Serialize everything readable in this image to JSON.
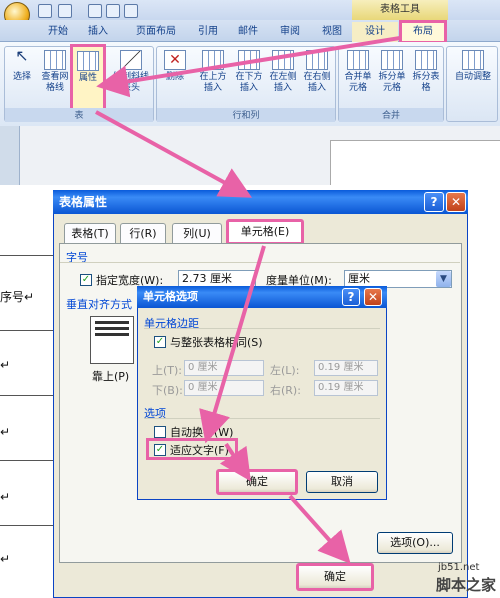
{
  "ribbon": {
    "context_tools": "表格工具",
    "tabs": [
      "开始",
      "插入",
      "页面布局",
      "引用",
      "邮件",
      "审阅",
      "视图",
      "设计",
      "布局"
    ],
    "groups": {
      "table": {
        "label": "表",
        "select": "选择",
        "gridlines": "查看网格线",
        "properties": "属性"
      },
      "draw": {
        "label": "绘制斜线表头"
      },
      "rows_cols": {
        "label": "行和列",
        "delete": "删除",
        "insert_above": "在上方插入",
        "insert_below": "在下方插入",
        "insert_left": "在左侧插入",
        "insert_right": "在右侧插入"
      },
      "merge": {
        "label": "合并",
        "merge_cells": "合并单元格",
        "split_cells": "拆分单元格",
        "split_table": "拆分表格"
      },
      "autofit": {
        "label": "自动调整"
      }
    }
  },
  "document": {
    "left_fragment_1": "序号↵",
    "left_fragment_2": "↵"
  },
  "table_props": {
    "title": "表格属性",
    "tabs": [
      "表格(T)",
      "行(R)",
      "列(U)",
      "单元格(E)"
    ],
    "section_size": "字号",
    "preferred_width_label": "指定宽度(W):",
    "preferred_width_value": "2.73 厘米",
    "measure_label": "度量单位(M):",
    "measure_value": "厘米",
    "valign_label": "垂直对齐方式",
    "top_label": "靠上(P)",
    "options_button": "选项(O)...",
    "ok_button": "确定"
  },
  "cell_options": {
    "title": "单元格选项",
    "margins_label": "单元格边距",
    "same_as_table": "与整张表格相同(S)",
    "top_label": "上(T):",
    "top_value": "0 厘米",
    "left_label": "左(L):",
    "left_value": "0.19 厘米",
    "bottom_label": "下(B):",
    "bottom_value": "0 厘米",
    "right_label": "右(R):",
    "right_value": "0.19 厘米",
    "options_label": "选项",
    "wrap_text": "自动换行(W)",
    "fit_text": "适应文字(F)",
    "ok_button": "确定",
    "cancel_button": "取消"
  },
  "watermark": {
    "url": "jb51.net",
    "name": "脚本之家"
  },
  "colors": {
    "highlight": "#e862a7",
    "xp_blue": "#0a5bda"
  }
}
